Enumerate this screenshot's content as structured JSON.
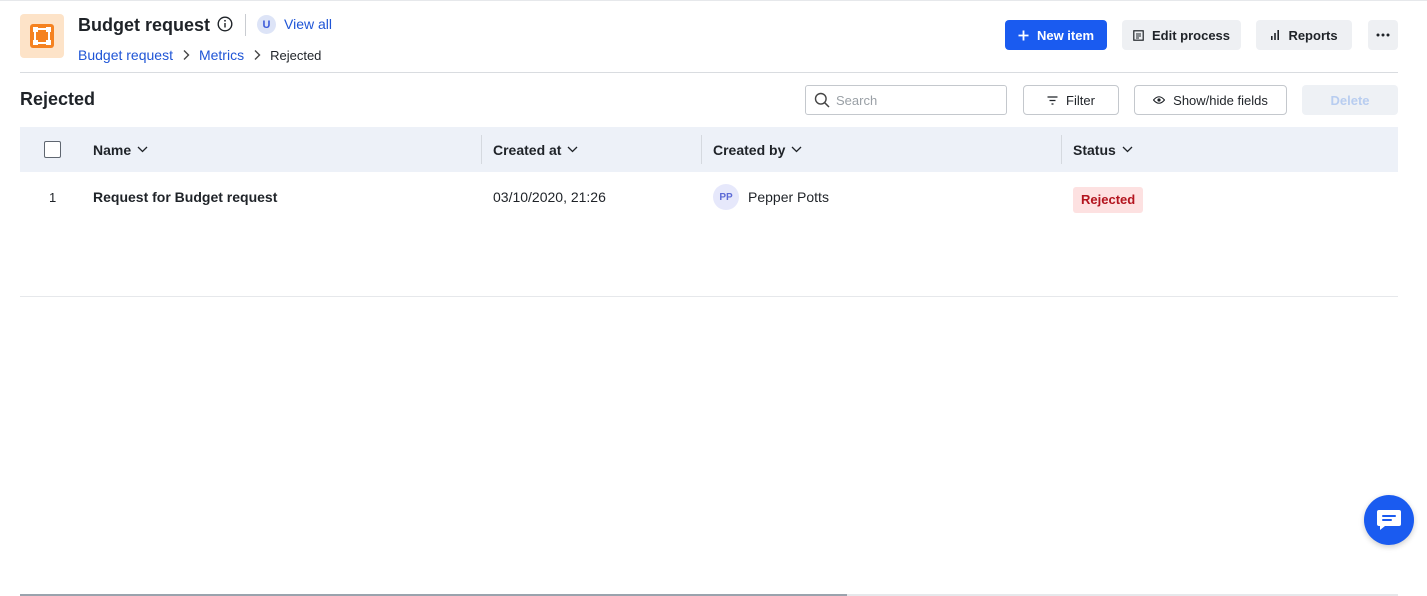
{
  "header": {
    "title": "Budget request",
    "view_all_avatar": "U",
    "view_all_label": "View all",
    "breadcrumb": [
      {
        "label": "Budget request"
      },
      {
        "label": "Metrics"
      },
      {
        "label": "Rejected"
      }
    ],
    "buttons": {
      "new_item": "New item",
      "edit_process": "Edit process",
      "reports": "Reports"
    }
  },
  "toolbar": {
    "section_title": "Rejected",
    "search_placeholder": "Search",
    "filter_label": "Filter",
    "show_hide_label": "Show/hide fields",
    "delete_label": "Delete"
  },
  "table": {
    "columns": [
      "Name",
      "Created at",
      "Created by",
      "Status"
    ],
    "rows": [
      {
        "index": "1",
        "name": "Request for Budget request",
        "created_at": "03/10/2020, 21:26",
        "created_by_initials": "PP",
        "created_by": "Pepper Potts",
        "status": "Rejected"
      }
    ]
  },
  "scroll_progress": 0.6,
  "colors": {
    "primary": "#1a5bf0",
    "app_icon": "#f58220",
    "status_rejected_bg": "#fde1e1",
    "status_rejected_text": "#b3141e"
  },
  "icons": {
    "app": "process-app-icon",
    "info": "info-icon",
    "new_item": "plus-icon",
    "edit_process": "document-icon",
    "reports": "bar-chart-icon",
    "more": "more-horizontal-icon",
    "search": "search-icon",
    "filter": "filter-icon",
    "show_hide": "eye-icon",
    "chat": "chat-icon"
  }
}
